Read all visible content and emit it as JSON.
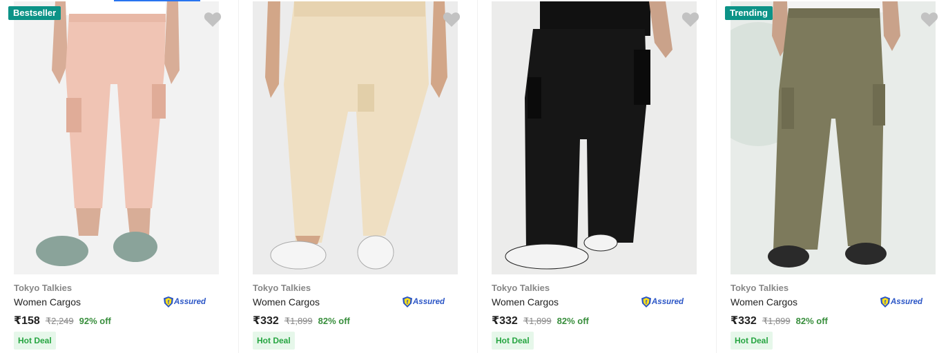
{
  "products": [
    {
      "badge": "Bestseller",
      "brand": "Tokyo Talkies",
      "name": "Women Cargos",
      "assured": "Assured",
      "price": "₹158",
      "mrp": "₹2,249",
      "discount": "92% off",
      "deal": "Hot Deal",
      "pant_color": "#f0c4b4",
      "bg_color": "#f2f2f2"
    },
    {
      "badge": "",
      "brand": "Tokyo Talkies",
      "name": "Women Cargos",
      "assured": "Assured",
      "price": "₹332",
      "mrp": "₹1,899",
      "discount": "82% off",
      "deal": "Hot Deal",
      "pant_color": "#efdfc2",
      "bg_color": "#ececec"
    },
    {
      "badge": "",
      "brand": "Tokyo Talkies",
      "name": "Women Cargos",
      "assured": "Assured",
      "price": "₹332",
      "mrp": "₹1,899",
      "discount": "82% off",
      "deal": "Hot Deal",
      "pant_color": "#161616",
      "bg_color": "#ececeb"
    },
    {
      "badge": "Trending",
      "brand": "Tokyo Talkies",
      "name": "Women Cargos",
      "assured": "Assured",
      "price": "₹332",
      "mrp": "₹1,899",
      "discount": "82% off",
      "deal": "Hot Deal",
      "pant_color": "#7d7a5c",
      "bg_color": "#e8ece9"
    }
  ],
  "icons": {
    "wishlist": "heart-icon",
    "assured": "flipkart-assured-shield-icon"
  },
  "colors": {
    "badge_bg": "#0c9387",
    "discount": "#388e3c",
    "deal_text": "#26a541",
    "deal_bg": "#e6f7ea",
    "assured_blue": "#2a55c6",
    "wishlist_gray": "#c2c2c2"
  }
}
